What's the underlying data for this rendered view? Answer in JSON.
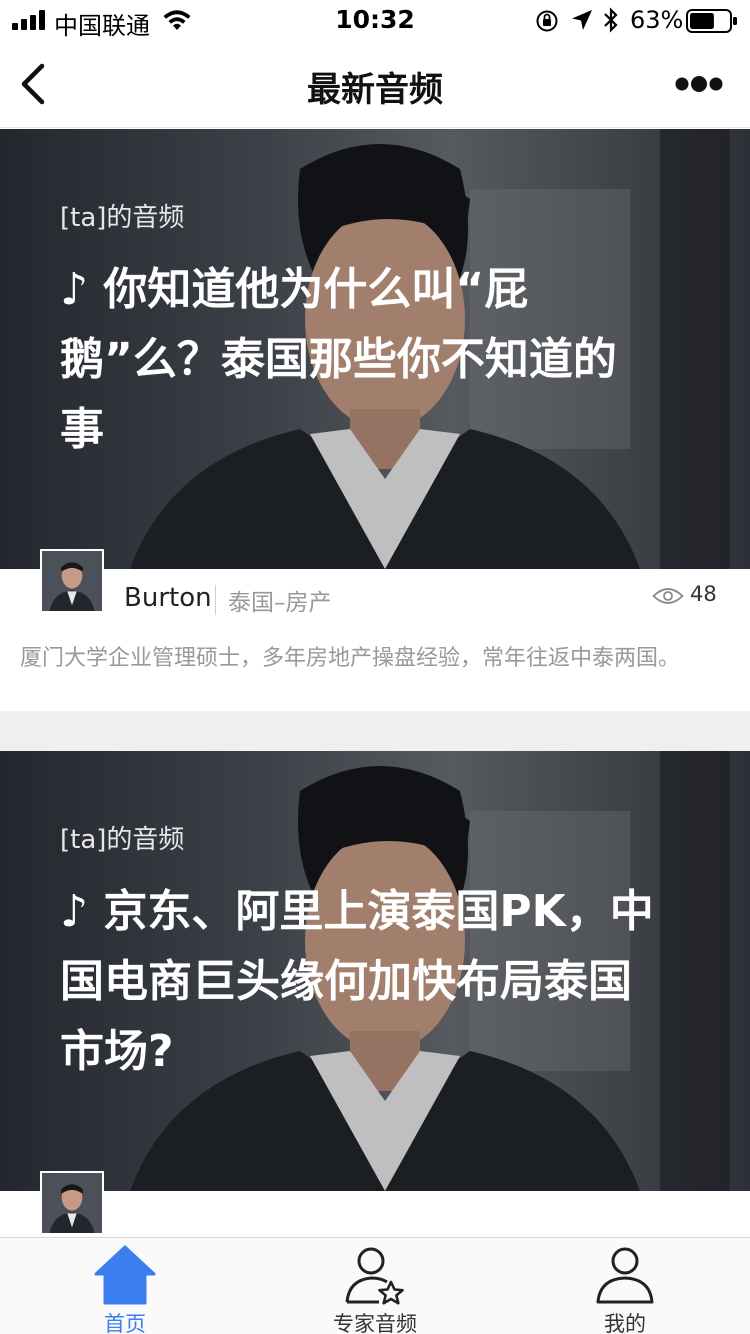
{
  "status_bar": {
    "carrier": "中国联通",
    "time": "10:32",
    "battery": "63%",
    "battery_level": 0.63
  },
  "nav": {
    "title": "最新音频",
    "back_icon": "chevron-left-icon",
    "more_icon": "more-dots-icon"
  },
  "cards": [
    {
      "tag": "[ta]的音频",
      "headline": "♪ 你知道他为什么叫“屁鹅”么？泰国那些你不知道的事",
      "author": "Burton",
      "field": "泰国–房产",
      "views": "48",
      "bio": "厦门大学企业管理硕士，多年房地产操盘经验，常年往返中泰两国。"
    },
    {
      "tag": "[ta]的音频",
      "headline": "♪ 京东、阿里上演泰国PK，中国电商巨头缘何加快布局泰国市场?"
    }
  ],
  "tabs": [
    {
      "label": "首页",
      "icon": "home-icon",
      "active": true
    },
    {
      "label": "专家音频",
      "icon": "expert-star-icon",
      "active": false
    },
    {
      "label": "我的",
      "icon": "user-icon",
      "active": false
    }
  ],
  "colors": {
    "accent": "#3c7ef0",
    "cover_dark": "#3a3f47"
  }
}
